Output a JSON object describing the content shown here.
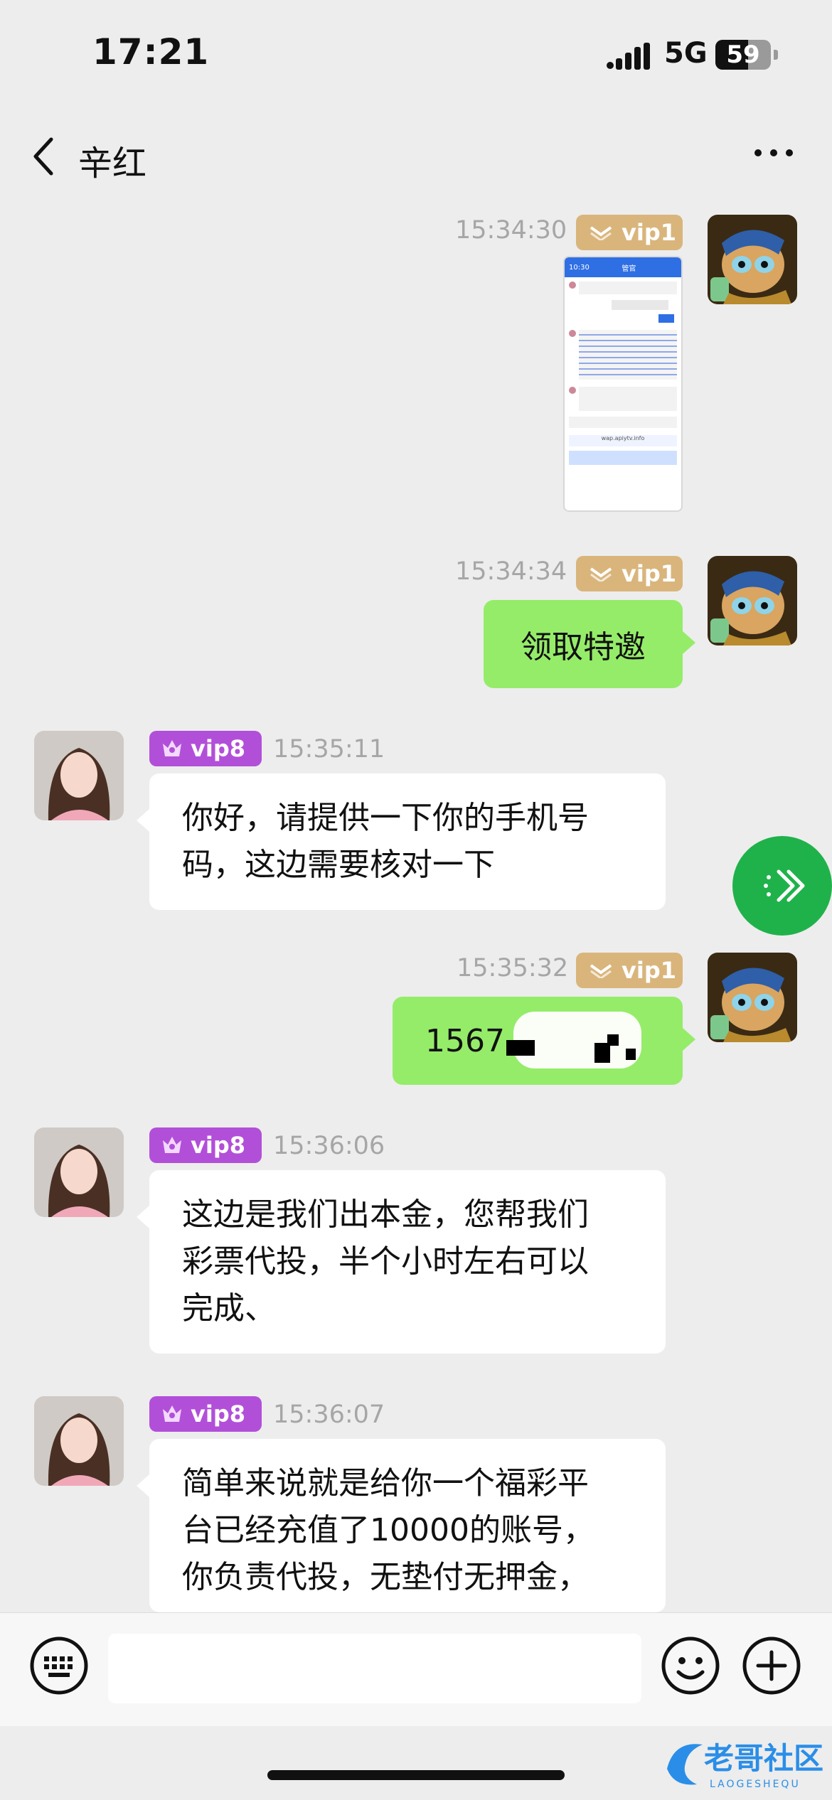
{
  "status_bar": {
    "time": "17:21",
    "network": "5G",
    "battery": "59",
    "battery_level": 0.59
  },
  "header": {
    "title": "辛红"
  },
  "messages": [
    {
      "side": "me",
      "timestamp": "15:34:30",
      "badge": "vip1",
      "type": "image"
    },
    {
      "side": "me",
      "timestamp": "15:34:34",
      "badge": "vip1",
      "type": "text",
      "text": "领取特邀"
    },
    {
      "side": "other",
      "timestamp": "15:35:11",
      "badge": "vip8",
      "type": "text",
      "lines": [
        "你好，请提供一下你的手机号",
        "码，这边需要核对一下"
      ]
    },
    {
      "side": "me",
      "timestamp": "15:35:32",
      "badge": "vip1",
      "type": "text",
      "text": "1567"
    },
    {
      "side": "other",
      "timestamp": "15:36:06",
      "badge": "vip8",
      "type": "text",
      "lines": [
        "这边是我们出本金，您帮我们",
        "彩票代投，半个小时左右可以",
        "完成、"
      ]
    },
    {
      "side": "other",
      "timestamp": "15:36:07",
      "badge": "vip8",
      "type": "text",
      "lines": [
        "简单来说就是给你一个福彩平",
        "台已经充值了10000的账号，",
        "你负责代投，无垫付无押金，"
      ]
    }
  ],
  "image_message": {
    "time": "10:30",
    "header": "管官",
    "url": "wap.apiytv.info"
  },
  "watermark": {
    "name": "老哥社区",
    "latin": "LAOGESHEQU"
  },
  "colors": {
    "background": "#ededed",
    "my_bubble": "#95ec69",
    "their_bubble": "#ffffff",
    "vip1": "#d9b57c",
    "vip8": "#b24fd9",
    "float": "#1fb24a"
  }
}
